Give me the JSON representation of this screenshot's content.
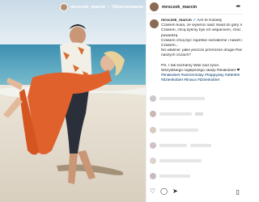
{
  "post": {
    "username": "mroczek_marcin",
    "separator": "•",
    "follow_label": "Obserwowanie",
    "more_label": "•••"
  },
  "caption": {
    "username": "mroczek_marcin",
    "verified": "✔",
    "lines": [
      "Ach te Kobiety",
      "Czasem kusa, że wywróci nasz świat do góry nogami 🙂",
      "Czasem, chcą byśmy byli ich wsparciem, choć same",
      "powiedzą",
      "Czasem chcą być zupełnie niezależne i nawet nie próbuj!",
      "Czasem...",
      "No właśnie: jakie jeszcze przeróżne drogie Panie w",
      "naszych oczach?",
      "",
      "PS. I tak kochamy Was nad życie.",
      "Wszystkiego najlepszego okazji #tinakobiet ❤"
    ],
    "hashtags": "#tinakobiet #womensday #happyday #afterlife #dzienkobiet #tinaca #dzienkobiet"
  },
  "icons": {
    "heart": "heart-icon",
    "comment": "comment-icon",
    "share": "share-icon",
    "bookmark": "bookmark-icon"
  }
}
